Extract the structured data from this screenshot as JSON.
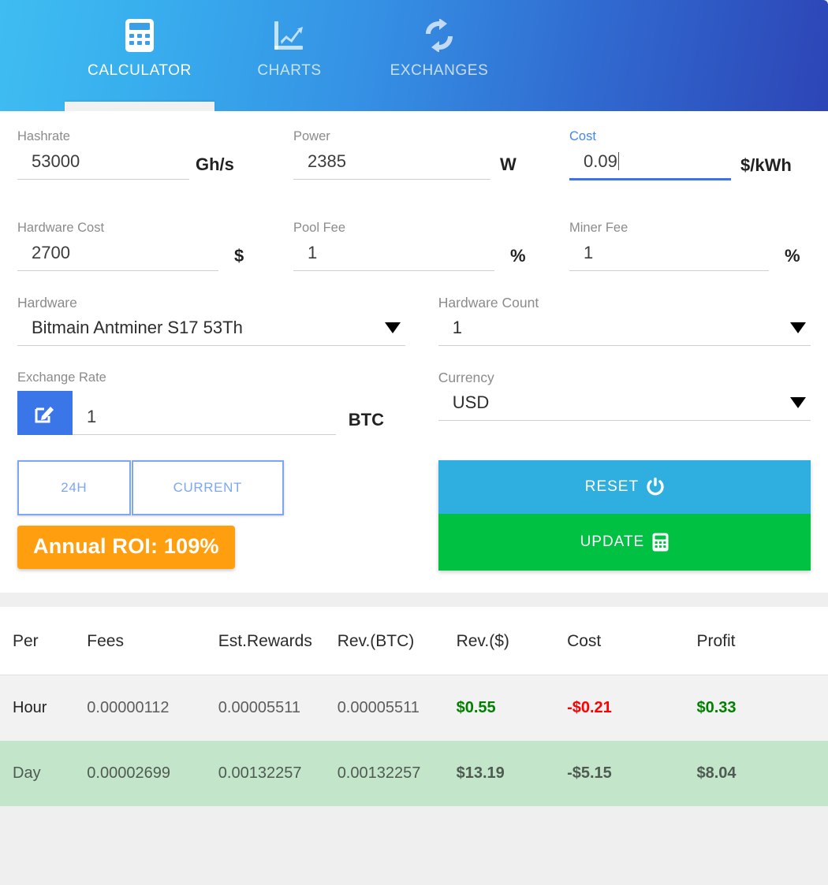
{
  "header": {
    "tabs": [
      {
        "label": "CALCULATOR",
        "icon": "calculator-icon",
        "active": true
      },
      {
        "label": "CHARTS",
        "icon": "line-chart-icon",
        "active": false
      },
      {
        "label": "EXCHANGES",
        "icon": "sync-exchange-icon",
        "active": false
      }
    ],
    "gradient_from": "#3fbdf1",
    "gradient_to": "#2d45b6"
  },
  "form": {
    "row1": [
      {
        "label": "Hashrate",
        "value": "53000",
        "unit": "Gh/s",
        "focused": false
      },
      {
        "label": "Power",
        "value": "2385",
        "unit": "W",
        "focused": false
      },
      {
        "label": "Cost",
        "value": "0.09",
        "unit": "$/kWh",
        "focused": true
      }
    ],
    "row2": [
      {
        "label": "Hardware Cost",
        "value": "2700",
        "unit": "$",
        "focused": false
      },
      {
        "label": "Pool Fee",
        "value": "1",
        "unit": "%",
        "focused": false
      },
      {
        "label": "Miner Fee",
        "value": "1",
        "unit": "%",
        "focused": false
      }
    ],
    "hardware": {
      "label": "Hardware",
      "value": "Bitmain Antminer S17 53Th"
    },
    "hardware_count": {
      "label": "Hardware Count",
      "value": "1"
    },
    "exchange_rate": {
      "label": "Exchange Rate",
      "value": "1",
      "unit": "BTC",
      "edit_icon": "edit-square-icon"
    },
    "currency": {
      "label": "Currency",
      "value": "USD"
    }
  },
  "actions": {
    "toggle_24h": "24H",
    "toggle_current": "CURRENT",
    "roi_badge": "Annual ROI: 109%",
    "roi_color": "#ff9e0e",
    "reset_label": "RESET",
    "reset_icon": "power-icon",
    "reset_color": "#2faee0",
    "update_label": "UPDATE",
    "update_icon": "calculator-icon",
    "update_color": "#00c142"
  },
  "results": {
    "columns": [
      "Per",
      "Fees",
      "Est.Rewards",
      "Rev.(BTC)",
      "Rev.($)",
      "Cost",
      "Profit"
    ],
    "rows": [
      {
        "per": "Hour",
        "fees": "0.00000112",
        "est_rewards": "0.00005511",
        "rev_btc": "0.00005511",
        "rev_usd": "$0.55",
        "cost": "-$0.21",
        "profit": "$0.33"
      },
      {
        "per": "Day",
        "fees": "0.00002699",
        "est_rewards": "0.00132257",
        "rev_btc": "0.00132257",
        "rev_usd": "$13.19",
        "cost": "-$5.15",
        "profit": "$8.04"
      }
    ],
    "positive_color": "#008000",
    "negative_color": "#ff0000"
  }
}
